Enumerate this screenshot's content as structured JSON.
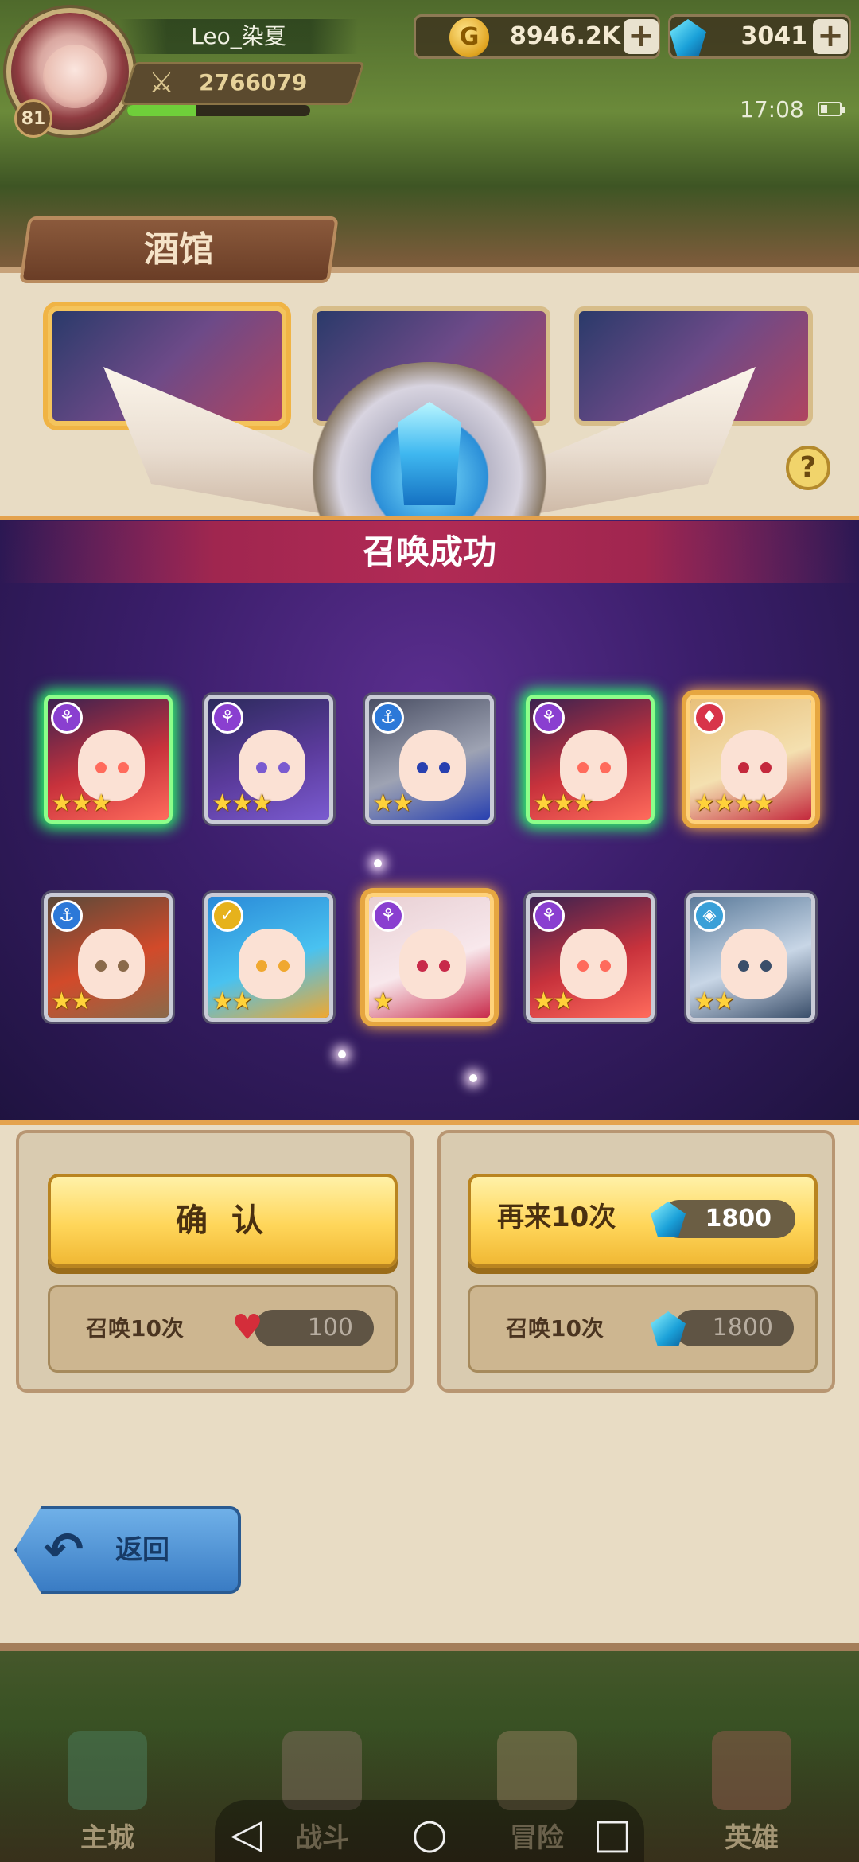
{
  "player": {
    "name": "Leo_染夏",
    "level": "81",
    "power": "2766079",
    "exp_fraction": 0.38
  },
  "resources": {
    "gold": "8946.2K",
    "gems": "3041",
    "plus": "+"
  },
  "status": {
    "time": "17:08"
  },
  "tavern": {
    "title": "酒馆",
    "help": "?"
  },
  "result": {
    "title": "召唤成功",
    "heroes": [
      {
        "faction": "dark",
        "faction_icon": "⚘",
        "stars": "★★★",
        "rarity": 3,
        "glow": "green",
        "palette": [
          "#3a2250",
          "#c8323c",
          "#ff6b5c"
        ]
      },
      {
        "faction": "dark",
        "faction_icon": "⚘",
        "stars": "★★★",
        "rarity": 3,
        "glow": "none",
        "palette": [
          "#2c2a5c",
          "#5b3b9c",
          "#7a5bd0"
        ]
      },
      {
        "faction": "water",
        "faction_icon": "⚓",
        "stars": "★★",
        "rarity": 2,
        "glow": "none",
        "palette": [
          "#4a4f64",
          "#9ea3b3",
          "#2840b0"
        ]
      },
      {
        "faction": "dark",
        "faction_icon": "⚘",
        "stars": "★★★",
        "rarity": 3,
        "glow": "green",
        "palette": [
          "#3a2250",
          "#c8323c",
          "#ff6b5c"
        ]
      },
      {
        "faction": "fire",
        "faction_icon": "♦",
        "stars": "★★★★",
        "rarity": 4,
        "glow": "gold",
        "palette": [
          "#e8c07a",
          "#f4e0b0",
          "#c4283c"
        ]
      },
      {
        "faction": "water",
        "faction_icon": "⚓",
        "stars": "★★",
        "rarity": 2,
        "glow": "none",
        "palette": [
          "#5a4a3a",
          "#d24a2a",
          "#8a6a4a"
        ]
      },
      {
        "faction": "light",
        "faction_icon": "✓",
        "stars": "★★",
        "rarity": 2,
        "glow": "none",
        "palette": [
          "#2a8ad8",
          "#49c2f0",
          "#f0a830"
        ]
      },
      {
        "faction": "dark",
        "faction_icon": "⚘",
        "stars": "★",
        "rarity": 1,
        "glow": "gold",
        "palette": [
          "#e8d0d4",
          "#f8e8ec",
          "#c82a4a"
        ]
      },
      {
        "faction": "dark",
        "faction_icon": "⚘",
        "stars": "★★",
        "rarity": 2,
        "glow": "none",
        "palette": [
          "#3a2250",
          "#c8323c",
          "#ff6b5c"
        ]
      },
      {
        "faction": "nature",
        "faction_icon": "◈",
        "stars": "★★",
        "rarity": 2,
        "glow": "none",
        "palette": [
          "#5a7a9a",
          "#c8d6e6",
          "#3a4e6a"
        ]
      }
    ]
  },
  "actions": {
    "confirm_label": "确 认",
    "again_label": "再来10次",
    "again_cost": "1800",
    "summon_left_label": "召唤10次",
    "summon_left_cost": "100",
    "summon_right_label": "召唤10次",
    "summon_right_cost": "1800",
    "back_label": "返回"
  },
  "nav": {
    "items": [
      {
        "label": "主城"
      },
      {
        "label": "战斗"
      },
      {
        "label": "冒险"
      },
      {
        "label": "英雄"
      }
    ]
  },
  "system": {
    "back": "◁",
    "home": "○",
    "recent": "□"
  },
  "colors": {
    "accent_gold": "#ffd65a",
    "overlay_purple": "#3b1e6b",
    "title_band": "#b12a55",
    "faction_dark": "#8a3fd0",
    "faction_water": "#2c78d8",
    "faction_fire": "#d8344a",
    "faction_light": "#e6b21c",
    "faction_nature": "#3aa0d8"
  }
}
